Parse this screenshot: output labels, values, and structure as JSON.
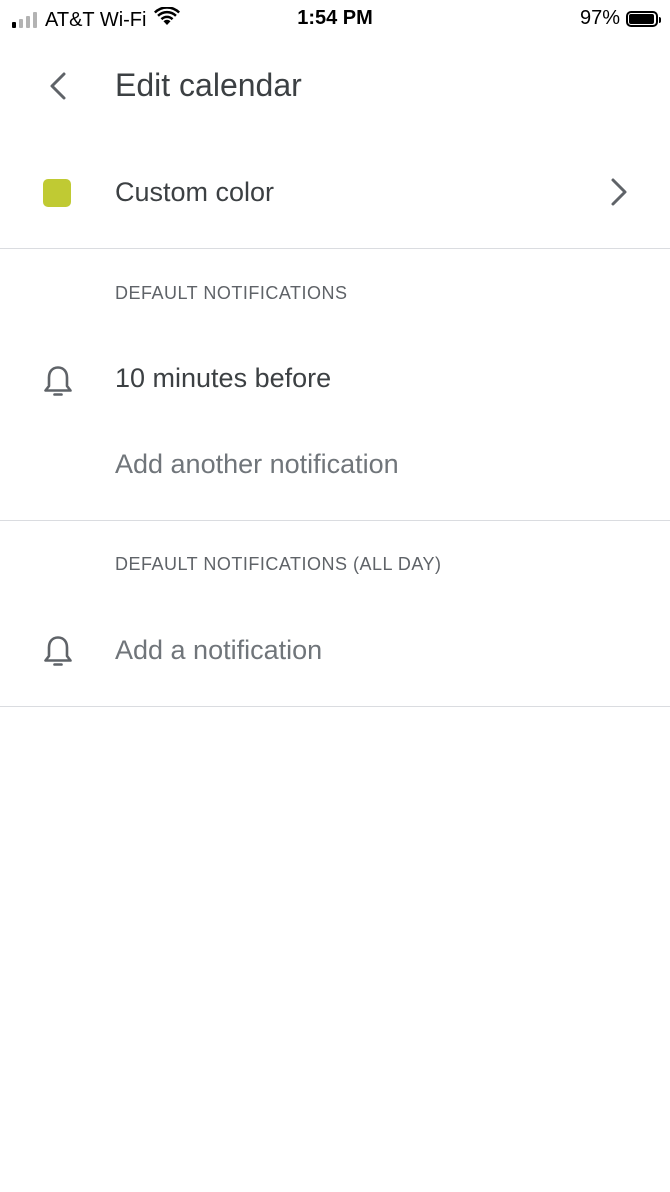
{
  "status_bar": {
    "carrier": "AT&T Wi-Fi",
    "time": "1:54 PM",
    "battery_percent": "97%",
    "battery_level": 0.97,
    "signal_bars_active": 1,
    "signal_bars_total": 4
  },
  "header": {
    "back_icon": "chevron-left-icon",
    "title": "Edit calendar"
  },
  "color_setting": {
    "label": "Custom color",
    "swatch_color": "#c0ca33",
    "chevron_icon": "chevron-right-icon"
  },
  "default_notifications": {
    "header": "DEFAULT NOTIFICATIONS",
    "items": [
      {
        "label": "10 minutes before",
        "icon": "bell-icon"
      }
    ],
    "add_label": "Add another notification"
  },
  "all_day_notifications": {
    "header": "DEFAULT NOTIFICATIONS (ALL DAY)",
    "add_label": "Add a notification",
    "icon": "bell-icon"
  }
}
